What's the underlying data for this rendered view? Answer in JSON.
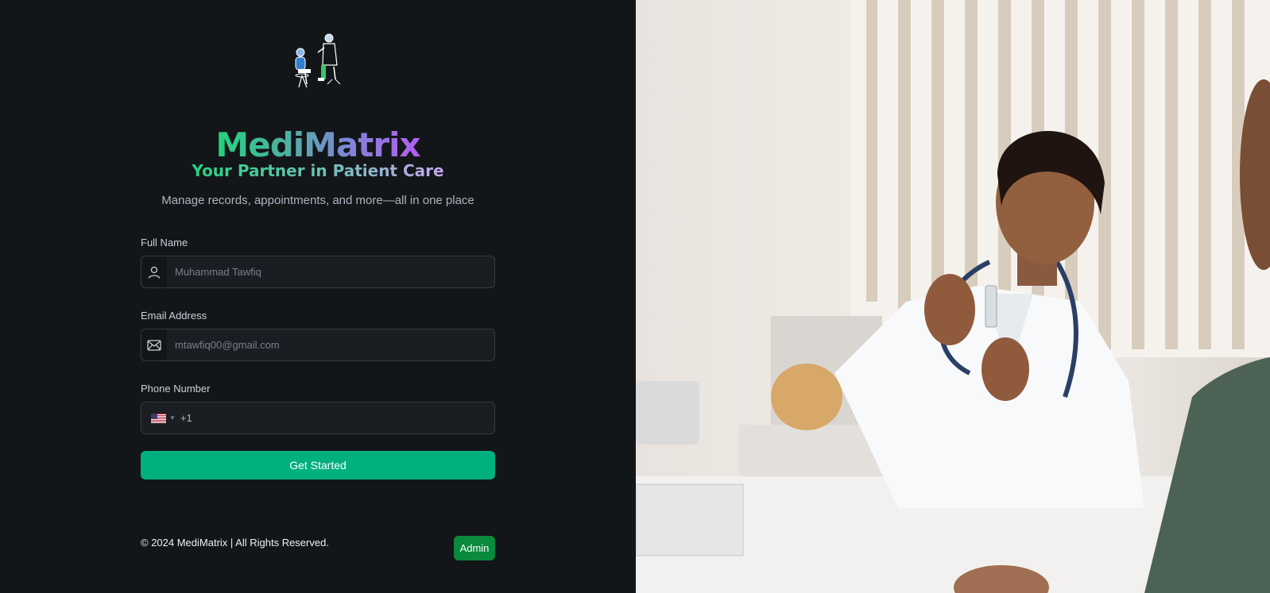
{
  "brand": {
    "name": "MediMatrix",
    "tagline": "Your Partner in Patient Care",
    "subtitle": "Manage records, appointments, and more—all in one place"
  },
  "form": {
    "full_name": {
      "label": "Full Name",
      "placeholder": "Muhammad Tawfiq",
      "icon": "user-icon"
    },
    "email": {
      "label": "Email Address",
      "placeholder": "mtawfiq00@gmail.com",
      "icon": "envelope-icon"
    },
    "phone": {
      "label": "Phone Number",
      "country_flag": "us-flag-icon",
      "country_code": "+1",
      "value": ""
    },
    "submit_label": "Get Started"
  },
  "footer": {
    "copyright": "© 2024 MediMatrix | All Rights Reserved.",
    "admin_label": "Admin"
  },
  "colors": {
    "background": "#131619",
    "accent": "#00b07f",
    "admin": "#0a8a3c",
    "brand_gradient_start": "#24d27f",
    "brand_gradient_end": "#b45df0"
  }
}
